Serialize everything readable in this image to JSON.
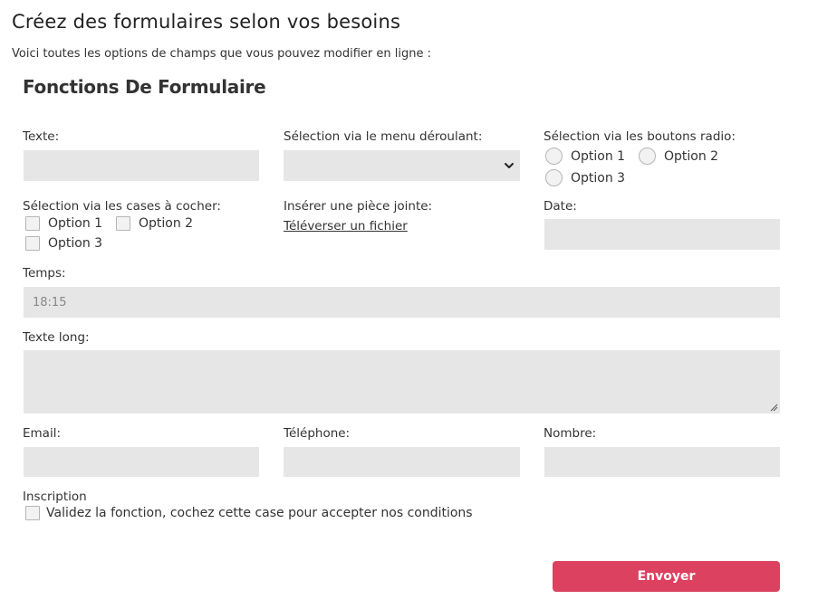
{
  "header": {
    "title": "Créez des formulaires selon vos besoins",
    "subtitle": "Voici toutes les options de champs que vous pouvez modifier en ligne :"
  },
  "form": {
    "title": "Fonctions De Formulaire",
    "text_field": {
      "label": "Texte:",
      "value": ""
    },
    "dropdown": {
      "label": "Sélection via le menu déroulant:",
      "selected": ""
    },
    "radio": {
      "label": "Sélection via les boutons radio:",
      "options": [
        "Option 1",
        "Option 2",
        "Option 3"
      ]
    },
    "checkboxes": {
      "label": "Sélection via les cases à cocher:",
      "options": [
        "Option 1",
        "Option 2",
        "Option 3"
      ]
    },
    "attachment": {
      "label": "Insérer une pièce jointe:",
      "link": "Téléverser un fichier"
    },
    "date": {
      "label": "Date:",
      "value": ""
    },
    "time": {
      "label": "Temps:",
      "value": "18:15"
    },
    "long_text": {
      "label": "Texte long:",
      "value": ""
    },
    "email": {
      "label": "Email:",
      "value": ""
    },
    "phone": {
      "label": "Téléphone:",
      "value": ""
    },
    "number": {
      "label": "Nombre:",
      "value": ""
    },
    "subscription": {
      "label": "Inscription",
      "checkbox_label": "Validez la fonction, cochez cette case pour accepter nos conditions"
    },
    "submit_label": "Envoyer"
  },
  "icons": {
    "dropdown_chevron": "chevron-down-icon",
    "textarea_resize": "resize-handle-icon"
  },
  "colors": {
    "field_background": "#e6e6e6",
    "submit_button": "#dc4160",
    "text": "#333333"
  }
}
